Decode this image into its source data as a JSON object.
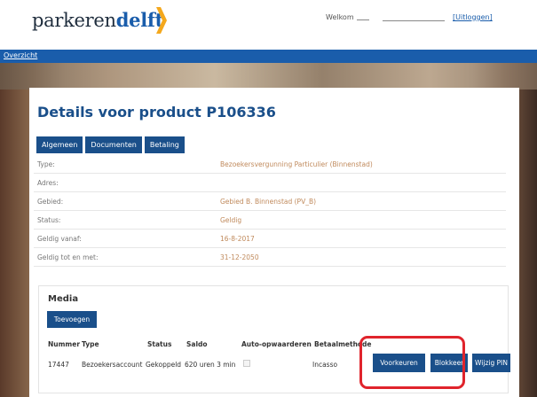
{
  "header": {
    "logo_part1": "parkeren",
    "logo_part2": "delft",
    "welcome": "Welkom",
    "logout": "[Uitloggen]",
    "brand_colors": {
      "blue": "#1a5dab",
      "orange": "#f4a81d"
    }
  },
  "nav": {
    "overview": "Overzicht"
  },
  "page": {
    "title": "Details voor product P106336"
  },
  "tabs": [
    "Algemeen",
    "Documenten",
    "Betaling"
  ],
  "details": [
    {
      "label": "Type:",
      "value": "Bezoekersvergunning Particulier (Binnenstad)"
    },
    {
      "label": "Adres:",
      "value": ""
    },
    {
      "label": "Gebied:",
      "value": "Gebied B. Binnenstad (PV_B)"
    },
    {
      "label": "Status:",
      "value": "Geldig"
    },
    {
      "label": "Geldig vanaf:",
      "value": "16-8-2017"
    },
    {
      "label": "Geldig tot en met:",
      "value": "31-12-2050"
    }
  ],
  "media": {
    "title": "Media",
    "add_label": "Toevoegen",
    "columns": [
      "Nummer",
      "Type",
      "Status",
      "Saldo",
      "Auto-opwaarderen",
      "Betaalmethode"
    ],
    "rows": [
      {
        "nummer": "17447",
        "type": "Bezoekersaccount",
        "status": "Gekoppeld",
        "saldo": "620 uren 3 min",
        "auto": false,
        "betaalmethode": "Incasso"
      }
    ],
    "actions": [
      "Voorkeuren",
      "Blokkeer",
      "Wijzig PIN"
    ]
  }
}
